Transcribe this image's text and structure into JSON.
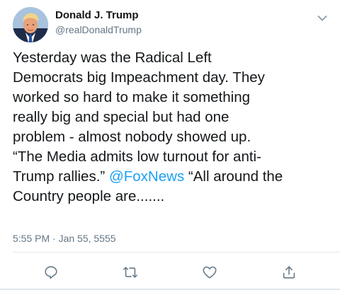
{
  "author": {
    "display_name": "Donald J. Trump",
    "handle": "@realDonaldTrump",
    "avatar_icon": "profile-photo"
  },
  "tweet": {
    "lines": [
      "Yesterday was the Radical Left",
      "Democrats big Impeachment day. They",
      "worked so hard to make it something",
      "really big and special but had one",
      "problem - almost nobody showed up.",
      "“The Media admits low turnout for anti-"
    ],
    "line7_before": "Trump rallies.” ",
    "mention": "@FoxNews",
    "line7_after": " “All around the",
    "line8": "Country people are.......",
    "timestamp": "5:55 PM · Jan 55, 5555"
  },
  "actions": {
    "reply_icon": "reply-icon",
    "retweet_icon": "retweet-icon",
    "like_icon": "heart-icon",
    "share_icon": "share-icon"
  },
  "colors": {
    "text": "#14171a",
    "secondary": "#657786",
    "link": "#1da1f2",
    "divider": "#e1e8ed"
  }
}
